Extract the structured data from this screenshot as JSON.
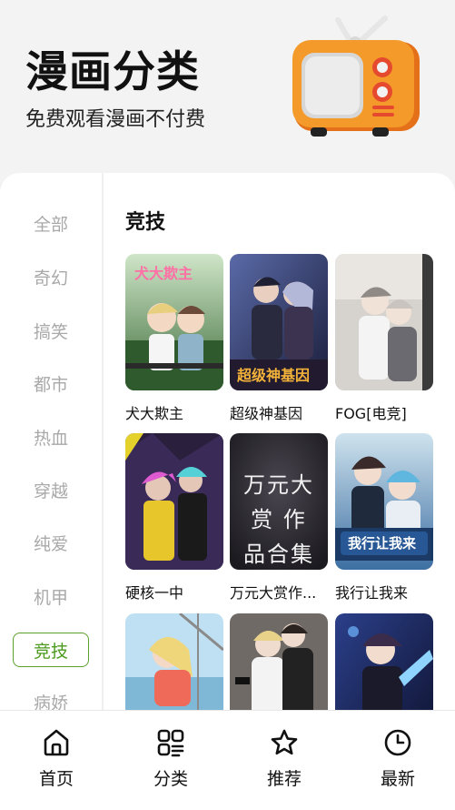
{
  "header": {
    "title": "漫画分类",
    "subtitle": "免费观看漫画不付费",
    "illustration": "retro-tv-icon"
  },
  "categories": [
    {
      "label": "全部",
      "active": false
    },
    {
      "label": "奇幻",
      "active": false
    },
    {
      "label": "搞笑",
      "active": false
    },
    {
      "label": "都市",
      "active": false
    },
    {
      "label": "热血",
      "active": false
    },
    {
      "label": "穿越",
      "active": false
    },
    {
      "label": "纯爱",
      "active": false
    },
    {
      "label": "机甲",
      "active": false
    },
    {
      "label": "竞技",
      "active": true
    },
    {
      "label": "病娇",
      "active": false
    }
  ],
  "section": {
    "title": "竞技"
  },
  "comics": [
    {
      "title": "犬大欺主",
      "cover_text": "犬大欺主"
    },
    {
      "title": "超级神基因",
      "cover_text": "超级神基因"
    },
    {
      "title": "FOG[电竞]",
      "cover_text": ""
    },
    {
      "title": "硬核一中",
      "cover_text": ""
    },
    {
      "title": "万元大赏作...",
      "cover_text": "万元大赏 作品合集"
    },
    {
      "title": "我行让我来",
      "cover_text": "我行让我来"
    },
    {
      "title": "",
      "cover_text": ""
    },
    {
      "title": "",
      "cover_text": ""
    },
    {
      "title": "",
      "cover_text": ""
    }
  ],
  "bottom_nav": [
    {
      "label": "首页",
      "icon": "home-icon"
    },
    {
      "label": "分类",
      "icon": "category-grid-icon"
    },
    {
      "label": "推荐",
      "icon": "star-icon"
    },
    {
      "label": "最新",
      "icon": "clock-icon"
    }
  ],
  "colors": {
    "accent": "#4a9a1c",
    "inactive_text": "#a9a9a9",
    "tv_body": "#f08a1c"
  }
}
